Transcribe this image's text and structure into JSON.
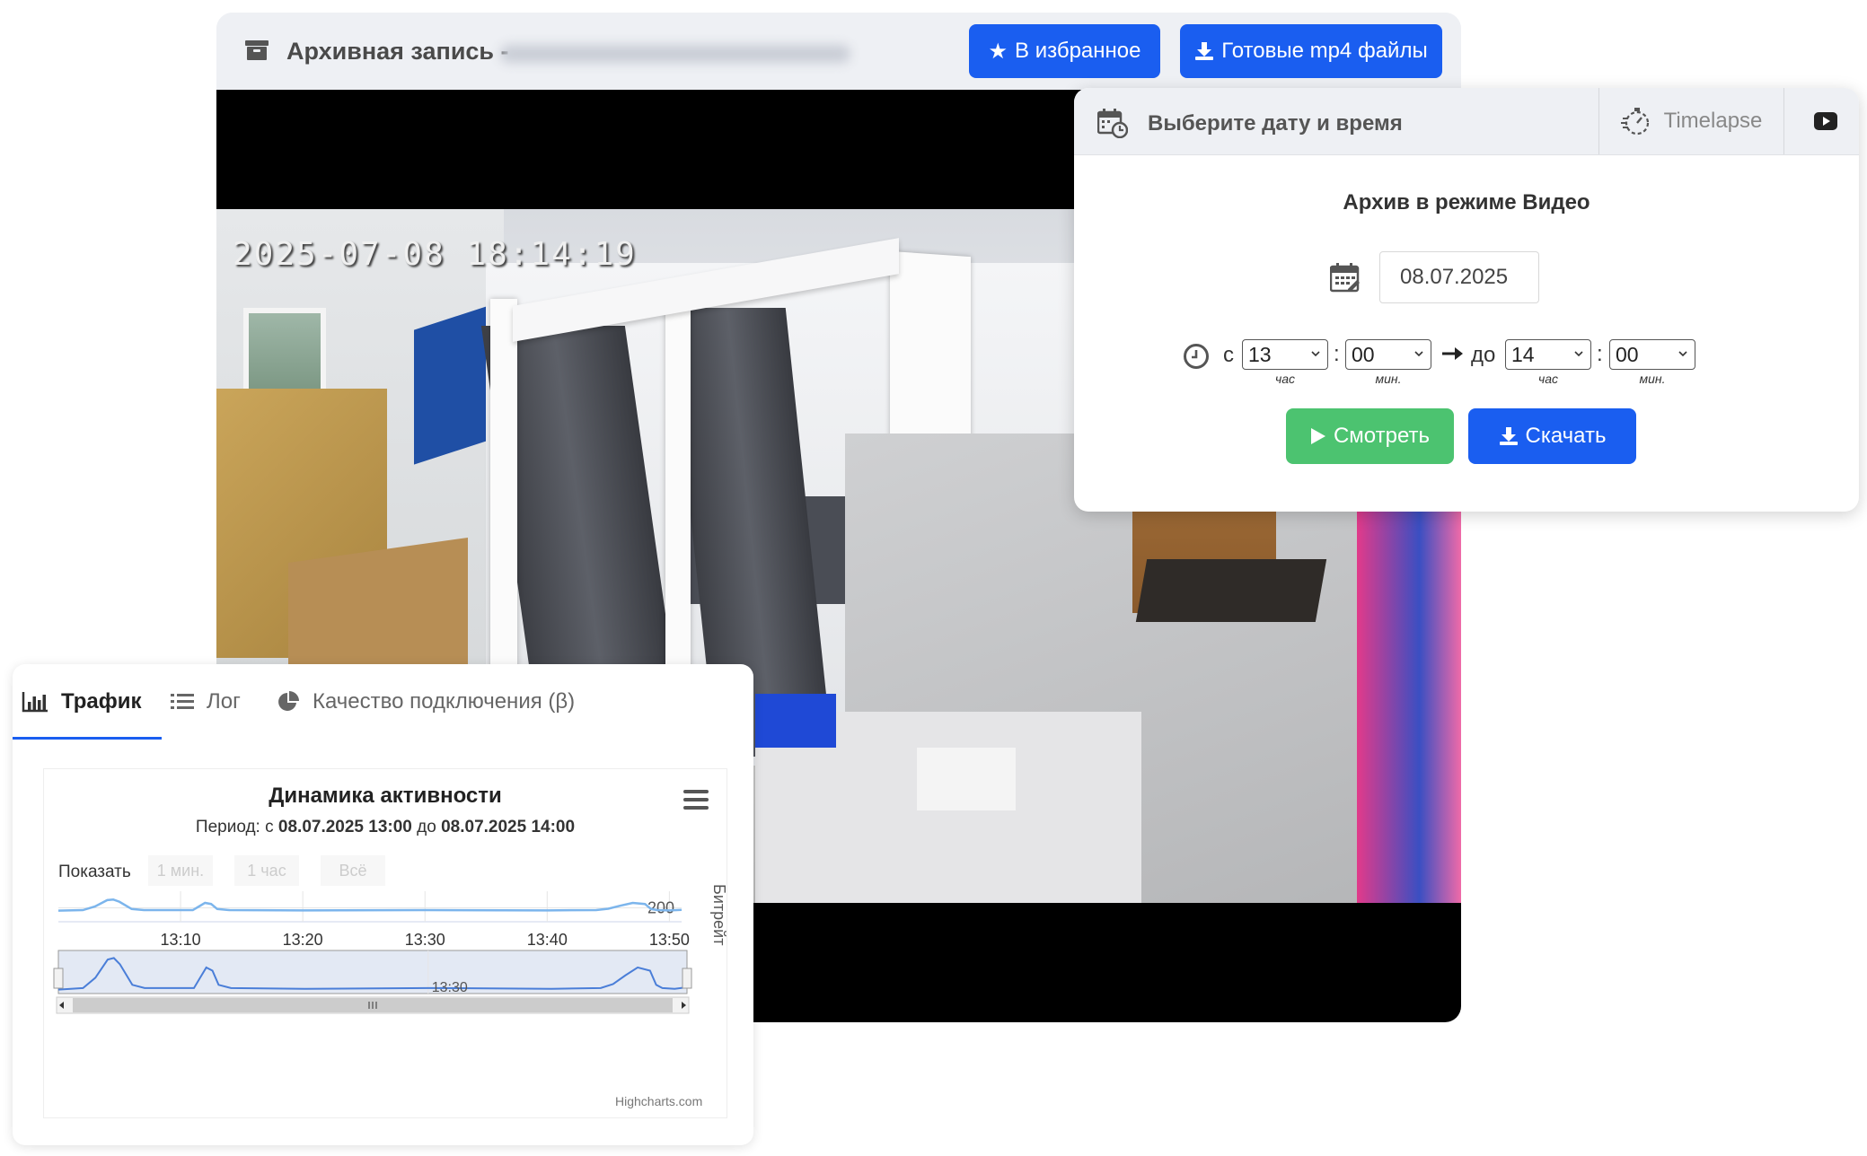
{
  "archive": {
    "title": "Архивная запись -",
    "favorite_label": "В избранное",
    "mp4_label": "Готовые mp4 файлы",
    "osd_timestamp": "2025-07-08 18:14:19"
  },
  "picker": {
    "title": "Выберите дату и время",
    "timelapse_label": "Timelapse",
    "mode_title": "Архив в режиме Видео",
    "date_value": "08.07.2025",
    "from_label": "с",
    "to_label": "до",
    "colon": ":",
    "from_hour": "13",
    "from_min": "00",
    "to_hour": "14",
    "to_min": "00",
    "hour_unit": "час",
    "min_unit": "мин.",
    "watch_label": "Смотреть",
    "download_label": "Скачать"
  },
  "traffic": {
    "tabs": [
      {
        "label": "Трафик"
      },
      {
        "label": "Лог"
      },
      {
        "label": "Качество подключения (β)"
      }
    ],
    "chart_title": "Динамика активности",
    "subtitle_prefix": "Период: с ",
    "subtitle_from": "08.07.2025 13:00",
    "subtitle_mid": " до ",
    "subtitle_to": "08.07.2025 14:00",
    "range_label": "Показать",
    "range_buttons": [
      "1 мин.",
      "1 час",
      "Всё"
    ],
    "credits": "Highcharts.com"
  },
  "colors": {
    "accent_blue": "#1a5ef0",
    "green": "#4cc370",
    "series": "#7cb5ec"
  },
  "chart_data": {
    "type": "line",
    "title": "Динамика активности",
    "ylabel": "Битрейт",
    "y_tick_labels": [
      "200"
    ],
    "x_tick_labels": [
      "13:10",
      "13:20",
      "13:30",
      "13:40",
      "13:50"
    ],
    "navigator_label": "13:30",
    "x_minutes": [
      0,
      2,
      3,
      4,
      4.5,
      5,
      6,
      7,
      11,
      11.5,
      12,
      12.5,
      13,
      14,
      20,
      30,
      40,
      44,
      45,
      46,
      47,
      48,
      48.5,
      49,
      50,
      51
    ],
    "values": [
      190,
      192,
      205,
      228,
      230,
      222,
      196,
      192,
      192,
      205,
      218,
      214,
      196,
      192,
      191,
      192,
      191,
      192,
      197,
      208,
      218,
      214,
      196,
      192,
      191,
      193
    ],
    "ylim": [
      150,
      260
    ],
    "xlim": [
      0,
      51
    ]
  }
}
